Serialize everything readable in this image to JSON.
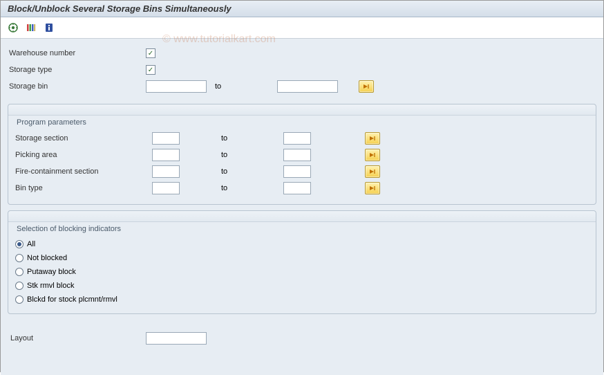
{
  "title": "Block/Unblock Several Storage Bins Simultaneously",
  "watermark": "© www.tutorialkart.com",
  "top": {
    "warehouse_label": "Warehouse number",
    "warehouse_checked": true,
    "storage_type_label": "Storage type",
    "storage_type_checked": true,
    "storage_bin_label": "Storage bin",
    "storage_bin_from": "",
    "to_label": "to",
    "storage_bin_to": ""
  },
  "params": {
    "group_title": "Program parameters",
    "rows": [
      {
        "label": "Storage section",
        "from": "",
        "to_label": "to",
        "to": ""
      },
      {
        "label": "Picking area",
        "from": "",
        "to_label": "to",
        "to": ""
      },
      {
        "label": "Fire-containment section",
        "from": "",
        "to_label": "to",
        "to": ""
      },
      {
        "label": "Bin type",
        "from": "",
        "to_label": "to",
        "to": ""
      }
    ]
  },
  "blocking": {
    "group_title": "Selection of blocking indicators",
    "options": [
      {
        "label": "All",
        "checked": true
      },
      {
        "label": "Not blocked",
        "checked": false
      },
      {
        "label": "Putaway block",
        "checked": false
      },
      {
        "label": "Stk rmvl block",
        "checked": false
      },
      {
        "label": "Blckd for stock plcmnt/rmvl",
        "checked": false
      }
    ]
  },
  "layout": {
    "label": "Layout",
    "value": ""
  }
}
